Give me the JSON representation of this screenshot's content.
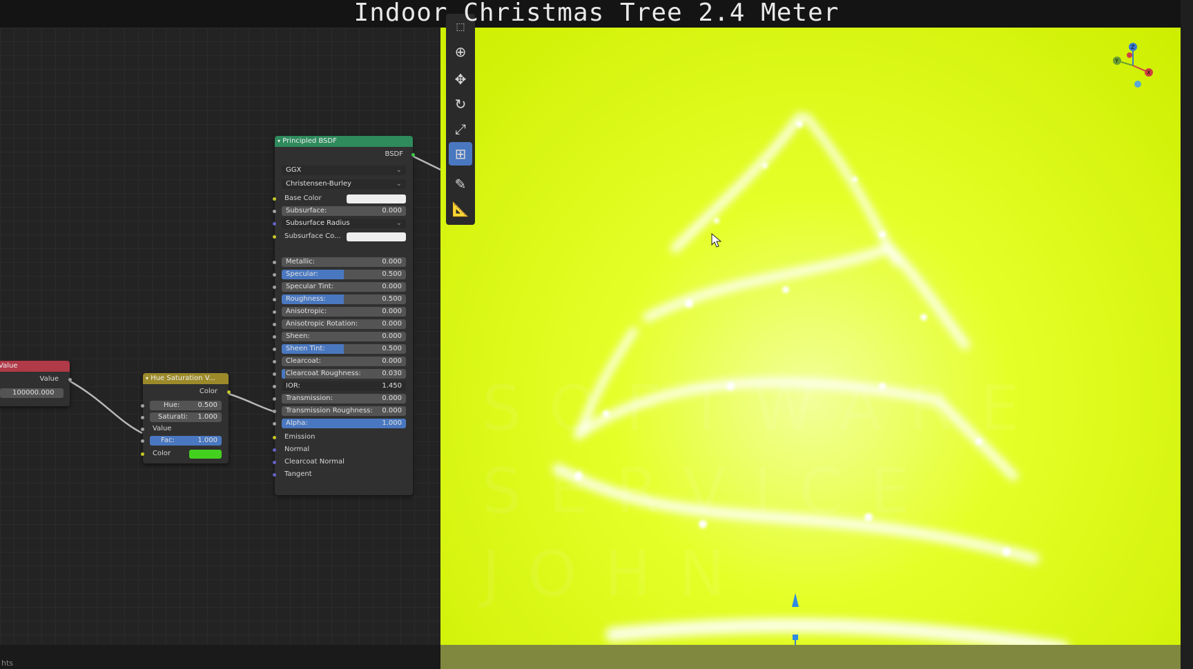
{
  "window": {
    "title": "Indoor Christmas Tree 2.4 Meter"
  },
  "status": {
    "text": "hts"
  },
  "nodes": {
    "value": {
      "title": "Value",
      "output_label": "Value",
      "value": "100000.000"
    },
    "hue_sat": {
      "title": "Hue Saturation V...",
      "output_label": "Color",
      "hue_label": "Hue:",
      "hue_value": "0.500",
      "sat_label": "Saturati:",
      "sat_value": "1.000",
      "value_label": "Value",
      "fac_label": "Fac:",
      "fac_value": "1.000",
      "color_label": "Color",
      "color_swatch": "#44d01e"
    },
    "bsdf": {
      "title": "Principled BSDF",
      "output_label": "BSDF",
      "distribution": "GGX",
      "subsurface_method": "Christensen-Burley",
      "base_color_label": "Base Color",
      "subsurface_radius_label": "Subsurface Radius",
      "subsurface_color_label": "Subsurface Co...",
      "fields": [
        {
          "label": "Subsurface:",
          "value": "0.000",
          "fill": 0
        },
        {
          "label": "Metallic:",
          "value": "0.000",
          "fill": 0
        },
        {
          "label": "Specular:",
          "value": "0.500",
          "fill": 0.5
        },
        {
          "label": "Specular Tint:",
          "value": "0.000",
          "fill": 0
        },
        {
          "label": "Roughness:",
          "value": "0.500",
          "fill": 0.5
        },
        {
          "label": "Anisotropic:",
          "value": "0.000",
          "fill": 0
        },
        {
          "label": "Anisotropic Rotation:",
          "value": "0.000",
          "fill": 0
        },
        {
          "label": "Sheen:",
          "value": "0.000",
          "fill": 0
        },
        {
          "label": "Sheen Tint:",
          "value": "0.500",
          "fill": 0.5
        },
        {
          "label": "Clearcoat:",
          "value": "0.000",
          "fill": 0
        },
        {
          "label": "Clearcoat Roughness:",
          "value": "0.030",
          "fill": 0.03
        },
        {
          "label": "IOR:",
          "value": "1.450",
          "fill": 0
        },
        {
          "label": "Transmission:",
          "value": "0.000",
          "fill": 0
        },
        {
          "label": "Transmission Roughness:",
          "value": "0.000",
          "fill": 0
        },
        {
          "label": "Alpha:",
          "value": "1.000",
          "fill": 1
        }
      ],
      "emission_label": "Emission",
      "normal_label": "Normal",
      "clearcoat_normal_label": "Clearcoat Normal",
      "tangent_label": "Tangent"
    }
  },
  "tools": [
    "select-box-icon",
    "cursor-icon",
    "move-icon",
    "rotate-icon",
    "scale-icon",
    "transform-icon",
    "annotate-icon",
    "measure-icon"
  ],
  "watermark": [
    "SOFTWARE",
    "SERVICE",
    "JOHN"
  ],
  "gizmo": {
    "x_label": "X",
    "y_label": "Y",
    "z_label": "Z"
  },
  "colors": {
    "value_header": "#b03a48",
    "hue_header": "#9c8a2a",
    "bsdf_header": "#2f8a5c",
    "accent": "#4a78c0",
    "viewport": "#e4ff28"
  }
}
